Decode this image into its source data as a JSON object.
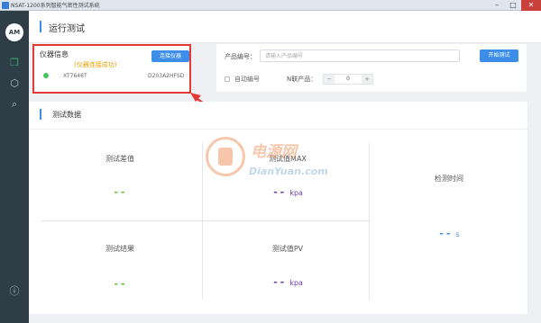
{
  "window": {
    "title": "NSAT-1200系列智能气密性测试系统"
  },
  "rail": {
    "logo_text": "AM",
    "icons": [
      "layers-icon",
      "settings-icon",
      "search-icon",
      "info-icon"
    ]
  },
  "header": {
    "title": "运行测试"
  },
  "instrument": {
    "label": "仪器信息",
    "status": "(仪器连接成功)",
    "connect_label": "连接仪器",
    "model": "XT7646T",
    "serial": "D203A2HFSD"
  },
  "product": {
    "label": "产品编号：",
    "placeholder": "请输入产品编号",
    "start_label": "开始测试",
    "auto_label": "自动编号",
    "n_label": "N联产品：",
    "count": "0",
    "minus": "−",
    "plus": "+"
  },
  "test_data": {
    "title": "测试数据",
    "metrics": {
      "diff": {
        "label": "测试差值",
        "value": "--"
      },
      "max": {
        "label": "测试值MAX",
        "value": "--",
        "unit": "kpa"
      },
      "time": {
        "label": "检测时间",
        "value": "--",
        "unit": "s"
      },
      "result": {
        "label": "测试结果",
        "value": "--"
      },
      "pv": {
        "label": "测试值PV",
        "value": "--",
        "unit": "kpa"
      }
    }
  },
  "watermark": {
    "cn": "电源网",
    "en": "DianYuan.com"
  },
  "colors": {
    "accent": "#3d8ee8",
    "rail": "#2f3d47",
    "success": "#47c45a",
    "status": "#e8a100",
    "highlight": "#e53935",
    "green": "#5dc23d",
    "purple": "#6a3eb6"
  }
}
